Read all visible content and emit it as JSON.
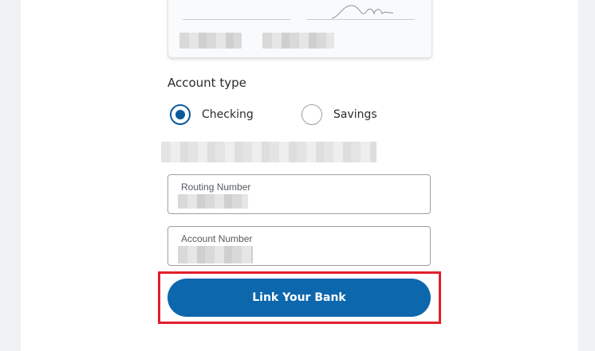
{
  "form": {
    "account_type_label": "Account type",
    "account_type_options": [
      {
        "label": "Checking",
        "selected": true
      },
      {
        "label": "Savings",
        "selected": false
      }
    ],
    "routing_number": {
      "label": "Routing Number",
      "value": ""
    },
    "account_number": {
      "label": "Account Number",
      "value": ""
    },
    "submit_label": "Link Your Bank"
  },
  "colors": {
    "primary": "#0d67ad",
    "radio_selected": "#0a5a9c",
    "highlight": "#e1202c",
    "background": "#f1f2f4"
  }
}
